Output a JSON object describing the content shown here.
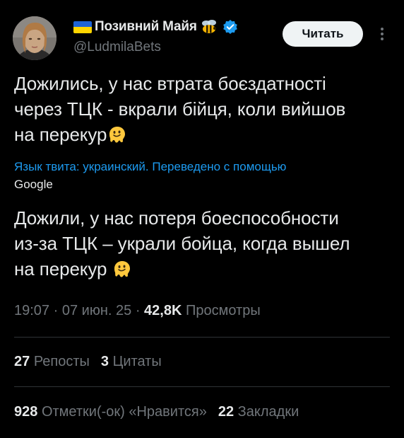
{
  "author": {
    "display_name": "Позивний Майя",
    "handle": "@LudmilaBets",
    "flag_colors": [
      "#1e63d6",
      "#ffd500"
    ],
    "badge_icon": "verified-icon",
    "badge_color": "#1d9bf0"
  },
  "follow_button": {
    "label": "Читать"
  },
  "original_text": {
    "line1": "Дожились, у нас втрата боєздатності",
    "line2": "через ТЦК - вкрали бійця, коли вийшов",
    "line3": "на перекур"
  },
  "translation_note": "Язык твита: украинский. Переведено с помощью",
  "translation_provider": "Google",
  "translated_text": {
    "line1": "Дожили, у нас потеря боеспособности",
    "line2": "из-за ТЦК – украли бойца, когда вышел",
    "line3": "на перекур"
  },
  "meta": {
    "time": "19:07",
    "date": "07 июн. 25",
    "views_count": "42,8K",
    "views_label": "Просмотры",
    "separator": "·"
  },
  "stats": {
    "reposts_count": "27",
    "reposts_label": "Репосты",
    "quotes_count": "3",
    "quotes_label": "Цитаты",
    "likes_count": "928",
    "likes_label": "Отметки(-ок) «Нравится»",
    "bookmarks_count": "22",
    "bookmarks_label": "Закладки"
  },
  "colors": {
    "background": "#000000",
    "text": "#e7e9ea",
    "secondary": "#71767b",
    "link": "#1d9bf0",
    "divider": "#2f3336"
  }
}
